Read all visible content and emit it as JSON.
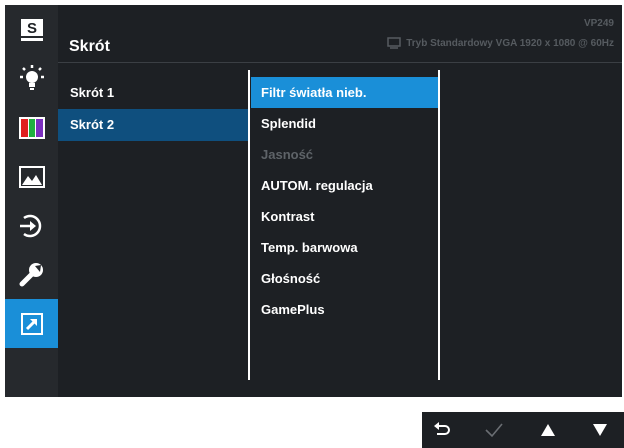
{
  "header": {
    "title": "Skrót",
    "model": "VP249",
    "status_text": "Tryb Standardowy VGA  1920 x 1080 @ 60Hz"
  },
  "sidebar": {
    "items": [
      {
        "icon": "splendid-s-icon"
      },
      {
        "icon": "blue-light-icon"
      },
      {
        "icon": "color-bars-icon"
      },
      {
        "icon": "image-icon"
      },
      {
        "icon": "input-select-icon"
      },
      {
        "icon": "wrench-icon"
      },
      {
        "icon": "shortcut-arrow-icon",
        "active": true
      }
    ]
  },
  "shortcuts": [
    {
      "label": "Skrót 1"
    },
    {
      "label": "Skrót 2",
      "selected": true
    }
  ],
  "options": [
    {
      "label": "Filtr światła nieb.",
      "selected": true
    },
    {
      "label": "Splendid"
    },
    {
      "label": "Jasność",
      "disabled": true
    },
    {
      "label": "AUTOM. regulacja"
    },
    {
      "label": "Kontrast"
    },
    {
      "label": "Temp. barwowa"
    },
    {
      "label": "Głośność"
    },
    {
      "label": "GamePlus"
    }
  ],
  "controls": [
    {
      "icon": "back-arrow-icon"
    },
    {
      "icon": "check-icon",
      "dimmed": true
    },
    {
      "icon": "up-triangle-icon"
    },
    {
      "icon": "down-triangle-icon"
    }
  ],
  "colors": {
    "accent": "#1a8fd8",
    "selected_dark": "#0f4f7e",
    "panel": "#1d2024",
    "disabled_text": "#5e6368"
  }
}
